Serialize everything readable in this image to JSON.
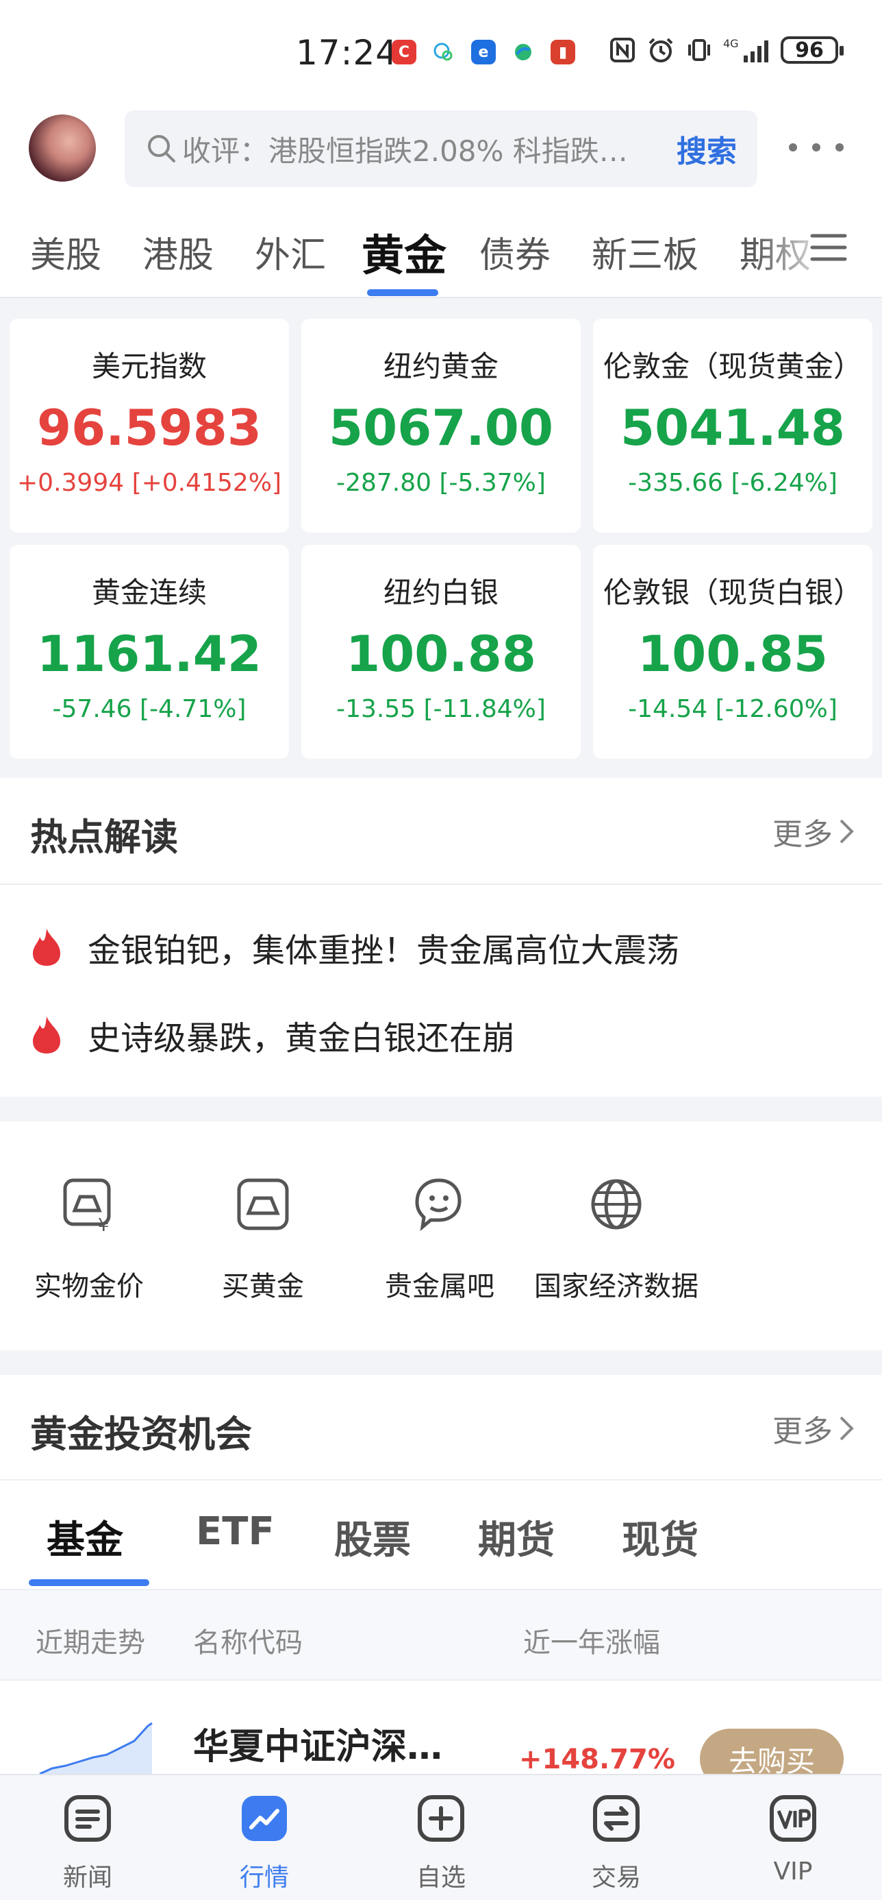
{
  "status_bar": {
    "time": "17:24",
    "network": "4G",
    "battery": "96"
  },
  "header": {
    "search_placeholder": "收评：港股恒指跌2.08% 科指跌…",
    "search_button": "搜索"
  },
  "market_tabs": [
    {
      "label": "美股",
      "active": false
    },
    {
      "label": "港股",
      "active": false
    },
    {
      "label": "外汇",
      "active": false
    },
    {
      "label": "黄金",
      "active": true
    },
    {
      "label": "债券",
      "active": false
    },
    {
      "label": "新三板",
      "active": false
    },
    {
      "label": "期权",
      "active": false
    }
  ],
  "quotes": [
    {
      "name": "美元指数",
      "price": "96.5983",
      "change": "+0.3994 [+0.4152%]",
      "direction": "up"
    },
    {
      "name": "纽约黄金",
      "price": "5067.00",
      "change": "-287.80 [-5.37%]",
      "direction": "down"
    },
    {
      "name": "伦敦金（现货黄金）",
      "price": "5041.48",
      "change": "-335.66 [-6.24%]",
      "direction": "down"
    },
    {
      "name": "黄金连续",
      "price": "1161.42",
      "change": "-57.46 [-4.71%]",
      "direction": "down"
    },
    {
      "name": "纽约白银",
      "price": "100.88",
      "change": "-13.55 [-11.84%]",
      "direction": "down"
    },
    {
      "name": "伦敦银（现货白银）",
      "price": "100.85",
      "change": "-14.54 [-12.60%]",
      "direction": "down"
    }
  ],
  "colors": {
    "up": "#e5433e",
    "down": "#16a34a",
    "accent": "#3d7cf0",
    "buy_button": "#c4a883"
  },
  "hot_reads": {
    "title": "热点解读",
    "more": "更多",
    "items": [
      "金银铂钯，集体重挫！贵金属高位大震荡",
      "史诗级暴跌，黄金白银还在崩"
    ]
  },
  "quick_links": [
    {
      "label": "实物金价",
      "icon": "gold-bar-price-icon"
    },
    {
      "label": "买黄金",
      "icon": "gold-bar-icon"
    },
    {
      "label": "贵金属吧",
      "icon": "chat-face-icon"
    },
    {
      "label": "国家经济数据",
      "icon": "globe-icon"
    }
  ],
  "opportunity": {
    "title": "黄金投资机会",
    "more": "更多",
    "tabs": [
      {
        "label": "基金",
        "active": true
      },
      {
        "label": "ETF",
        "active": false
      },
      {
        "label": "股票",
        "active": false
      },
      {
        "label": "期货",
        "active": false
      },
      {
        "label": "现货",
        "active": false
      }
    ],
    "columns": [
      "近期走势",
      "名称代码",
      "近一年涨幅"
    ],
    "rows": [
      {
        "name": "华夏中证沪深…",
        "rate": "+148.77%",
        "action": "去购买"
      }
    ]
  },
  "bottom_nav": [
    {
      "label": "新闻",
      "icon": "news-icon",
      "active": false
    },
    {
      "label": "行情",
      "icon": "market-chart-icon",
      "active": true
    },
    {
      "label": "自选",
      "icon": "add-watchlist-icon",
      "active": false
    },
    {
      "label": "交易",
      "icon": "trade-exchange-icon",
      "active": false
    },
    {
      "label": "VIP",
      "icon": "vip-icon",
      "active": false
    }
  ]
}
